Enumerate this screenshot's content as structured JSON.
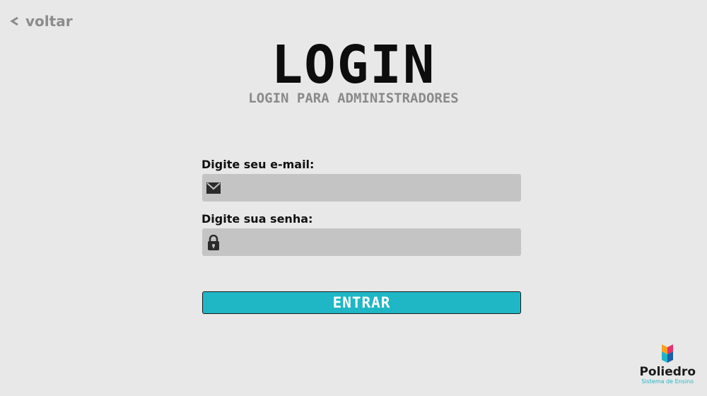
{
  "nav": {
    "back_label": "voltar"
  },
  "header": {
    "title": "LOGIN",
    "subtitle": "LOGIN PARA ADMINISTRADORES"
  },
  "form": {
    "email_label": "Digite seu e-mail:",
    "email_value": "",
    "email_icon": "envelope-icon",
    "password_label": "Digite sua senha:",
    "password_value": "",
    "password_icon": "lock-icon",
    "submit_label": "ENTRAR"
  },
  "brand": {
    "name": "Poliedro",
    "tagline": "Sistema de Ensino"
  },
  "colors": {
    "background": "#e8e8e8",
    "field": "#c4c4c4",
    "accent": "#1fb6c6",
    "muted_text": "#8a8a8a"
  }
}
